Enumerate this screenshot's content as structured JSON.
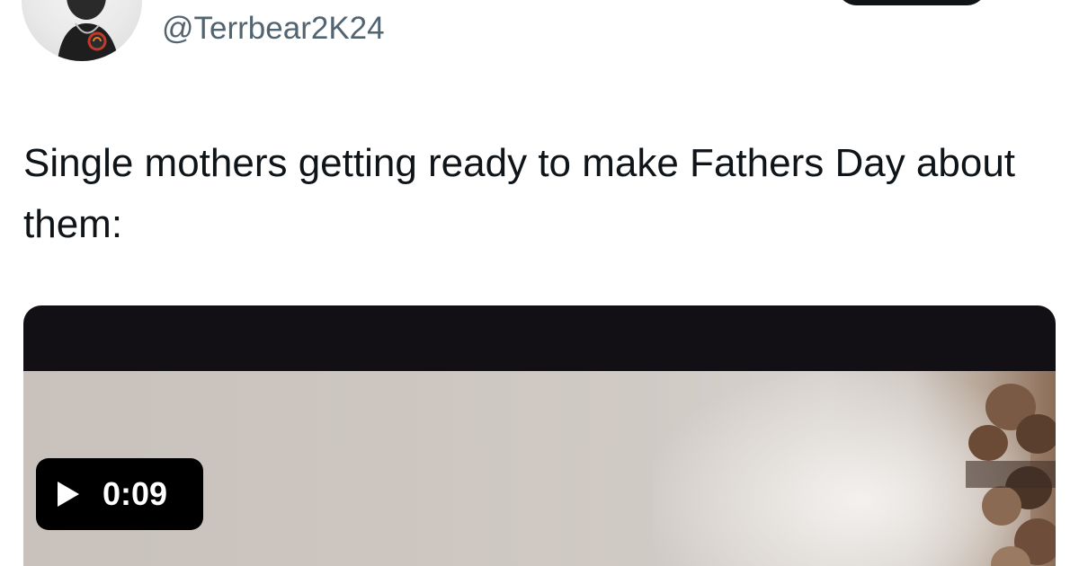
{
  "tweet": {
    "handle": "@Terrbear2K24",
    "text": "Single mothers getting ready to make Fathers Day about them:"
  },
  "media": {
    "duration": "0:09",
    "play_icon": "play-icon"
  },
  "colors": {
    "text_primary": "#0f1419",
    "text_secondary": "#536471",
    "badge_background": "#000000"
  }
}
